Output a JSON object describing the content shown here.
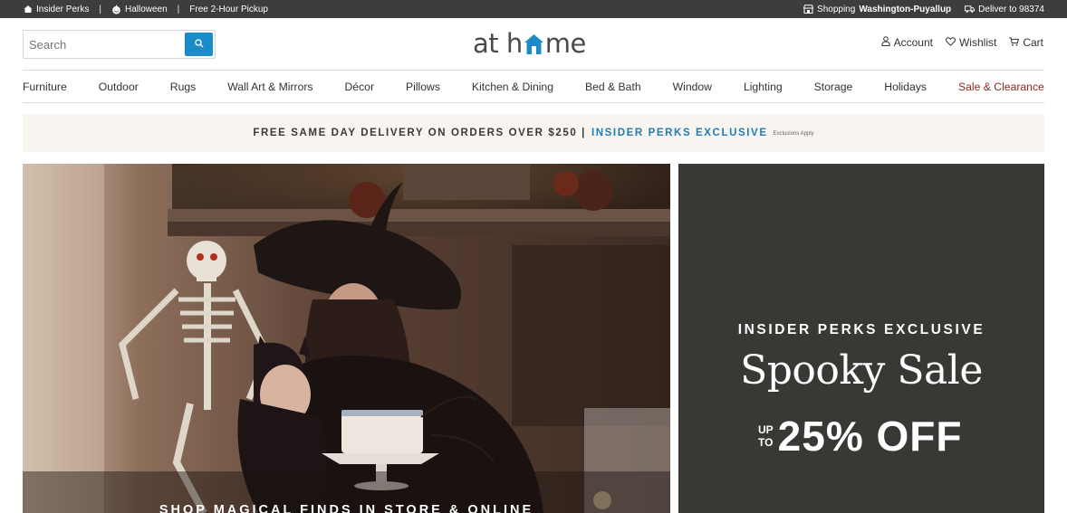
{
  "topbar": {
    "left": [
      {
        "icon": "home-icon",
        "label": "Insider Perks"
      },
      {
        "icon": "pumpkin-icon",
        "label": "Halloween"
      },
      {
        "icon": "",
        "label": "Free 2-Hour Pickup"
      }
    ],
    "separator": "|",
    "shopping_prefix": "Shopping",
    "shopping_store": "Washington-Puyallup",
    "deliver_label": "Deliver to 98374"
  },
  "header": {
    "search_placeholder": "Search",
    "logo_left": "at h",
    "logo_right": "me",
    "account_label": "Account",
    "wishlist_label": "Wishlist",
    "cart_label": "Cart"
  },
  "nav": {
    "items": [
      "Furniture",
      "Outdoor",
      "Rugs",
      "Wall Art & Mirrors",
      "Décor",
      "Pillows",
      "Kitchen & Dining",
      "Bed & Bath",
      "Window",
      "Lighting",
      "Storage",
      "Holidays",
      "Sale & Clearance"
    ]
  },
  "promo": {
    "main": "FREE SAME DAY DELIVERY ON ORDERS OVER $250 |",
    "link": "INSIDER PERKS EXCLUSIVE",
    "fine_print": "Exclusions Apply"
  },
  "hero": {
    "caption": "SHOP MAGICAL FINDS IN STORE & ONLINE"
  },
  "panel": {
    "eyebrow": "INSIDER PERKS EXCLUSIVE",
    "title": "Spooky Sale",
    "up": "UP",
    "to": "TO",
    "percent": "25% OFF"
  },
  "colors": {
    "topbar_bg": "#3d3d3d",
    "accent_blue": "#1c8cc8",
    "sale_red": "#8b2a1e",
    "promo_bg": "#f8f4ef",
    "panel_bg": "#3a3835"
  }
}
